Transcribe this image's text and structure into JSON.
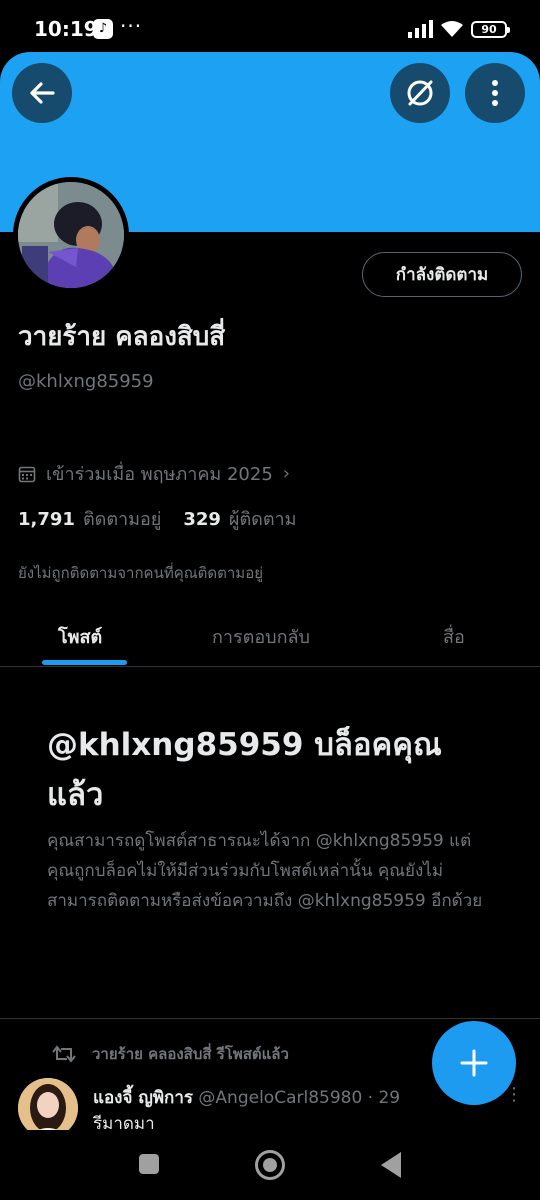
{
  "status_bar": {
    "time": "10:19",
    "tiktok_glyph": "♪",
    "overflow": "···",
    "battery": "90"
  },
  "header": {
    "back_icon": "arrow-left-icon",
    "grok_icon": "grok-icon",
    "more_icon": "vertical-dots-icon",
    "banner_color": "#1da1f2"
  },
  "profile": {
    "follow_button": "กำลังติดตาม",
    "display_name": "วายร้าย คลองสิบสี่",
    "handle": "@khlxng85959",
    "joined": "เข้าร่วมเมื่อ พฤษภาคม 2025",
    "following_count": "1,791",
    "following_label": "ติดตามอยู่",
    "followers_count": "329",
    "followers_label": "ผู้ติดตาม",
    "not_followed_note": "ยังไม่ถูกติดตามจากคนที่คุณติดตามอยู่"
  },
  "tabs": [
    {
      "label": "โพสต์",
      "active": true
    },
    {
      "label": "การตอบกลับ",
      "active": false
    },
    {
      "label": "สื่อ",
      "active": false
    }
  ],
  "blocked": {
    "title": "@khlxng85959 บล็อคคุณแล้ว",
    "text": "คุณสามารถดูโพสต์สาธารณะได้จาก @khlxng85959 แต่คุณถูกบล็อคไม่ให้มีส่วนร่วมกับโพสต์เหล่านั้น คุณยังไม่สามารถติดตามหรือส่งข้อความถึง @khlxng85959 อีกด้วย"
  },
  "tweet": {
    "repost_label": "วายร้าย คลองสิบสี่ รีโพสต์แล้ว",
    "author": "แองจี้ ญพิการ",
    "author_handle": "@AngeloCarl85980 · 29",
    "text": "รีมาดูมา"
  },
  "fab": {
    "icon": "plus-icon",
    "color": "#1d9bf0"
  },
  "accent_color": "#1d9bf0"
}
